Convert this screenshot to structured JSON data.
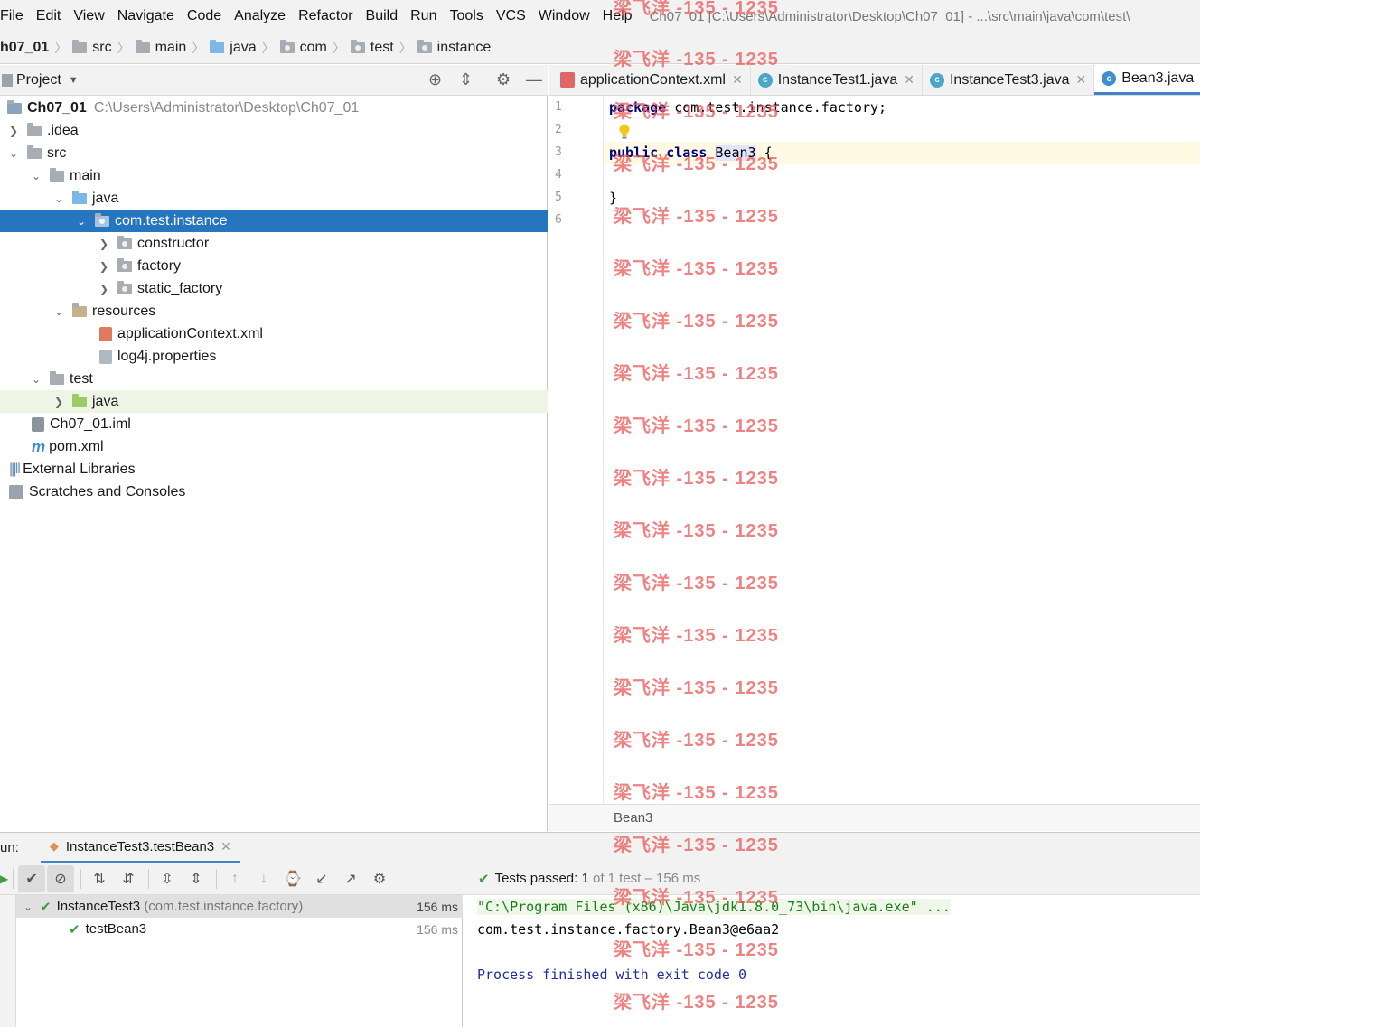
{
  "menu": {
    "items": [
      "File",
      "Edit",
      "View",
      "Navigate",
      "Code",
      "Analyze",
      "Refactor",
      "Build",
      "Run",
      "Tools",
      "VCS",
      "Window",
      "Help"
    ],
    "window_title": "Ch07_01 [C:\\Users\\Administrator\\Desktop\\Ch07_01] - ...\\src\\main\\java\\com\\test\\"
  },
  "breadcrumb": [
    "h07_01",
    "src",
    "main",
    "java",
    "com",
    "test",
    "instance"
  ],
  "project": {
    "header": "Project",
    "tree": [
      {
        "label": "Ch07_01",
        "path": "C:\\Users\\Administrator\\Desktop\\Ch07_01"
      },
      {
        "label": ".idea"
      },
      {
        "label": "src"
      },
      {
        "label": "main"
      },
      {
        "label": "java"
      },
      {
        "label": "com.test.instance"
      },
      {
        "label": "constructor"
      },
      {
        "label": "factory"
      },
      {
        "label": "static_factory"
      },
      {
        "label": "resources"
      },
      {
        "label": "applicationContext.xml"
      },
      {
        "label": "log4j.properties"
      },
      {
        "label": "test"
      },
      {
        "label": "java"
      },
      {
        "label": "Ch07_01.iml"
      },
      {
        "label": "pom.xml"
      },
      {
        "label": "External Libraries"
      },
      {
        "label": "Scratches and Consoles"
      }
    ]
  },
  "editor": {
    "tabs": [
      "applicationContext.xml",
      "InstanceTest1.java",
      "InstanceTest3.java",
      "Bean3.java"
    ],
    "line_numbers": [
      "1",
      "2",
      "3",
      "4",
      "5",
      "6"
    ],
    "code": {
      "l1_kw": "package",
      "l1_rest": " com.test.instance.factory;",
      "l3_kw1": "public",
      "l3_kw2": "class",
      "l3_name": "Bean3",
      "l3_rest": " {",
      "l5": "}"
    },
    "footer": "Bean3"
  },
  "run": {
    "label": "un:",
    "tab": "InstanceTest3.testBean3",
    "status_prefix": "Tests passed:",
    "status_count": "1",
    "status_rest": "of 1 test – 156 ms",
    "tests": [
      {
        "name": "InstanceTest3",
        "package": "(com.test.instance.factory)",
        "time": "156 ms"
      },
      {
        "name": "testBean3",
        "time": "156 ms"
      }
    ],
    "console": [
      "\"C:\\Program Files (x86)\\Java\\jdk1.8.0_73\\bin\\java.exe\" ...",
      "com.test.instance.factory.Bean3@e6aa2",
      "",
      "Process finished with exit code 0"
    ]
  },
  "watermark": "梁飞洋 -135 - 1235",
  "colors": {
    "selection": "#2675bf",
    "keyword": "#000080",
    "watermark": "#e85a5a",
    "pass": "#3e9d3e"
  }
}
